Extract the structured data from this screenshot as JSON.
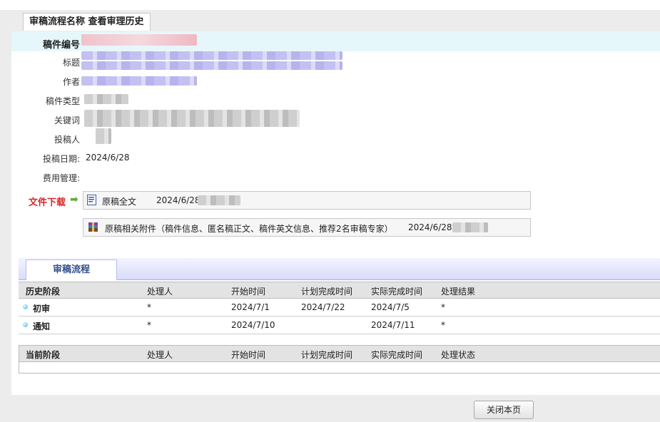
{
  "window_tab": "审稿流程名称 查看审理历史",
  "fields": {
    "manuscript_no": "稿件编号",
    "title": "标题",
    "author": "作者",
    "type": "稿件类型",
    "keywords": "关键词",
    "submitter": "投稿人",
    "submit_date_label": "投稿日期:",
    "submit_date_value": "2024/6/28",
    "fee_mgmt": "费用管理:"
  },
  "downloads": {
    "label": "文件下载",
    "files": [
      {
        "name": "原稿全文",
        "date": "2024/6/28"
      },
      {
        "name": "原稿相关附件（稿件信息、匿名稿正文、稿件英文信息、推荐2名审稿专家）",
        "date": "2024/6/28"
      }
    ]
  },
  "section_tab": "审稿流程",
  "history": {
    "headers": [
      "历史阶段",
      "处理人",
      "开始时间",
      "计划完成时间",
      "实际完成时间",
      "处理结果"
    ],
    "rows": [
      {
        "stage": "初审",
        "handler": "*",
        "start": "2024/7/1",
        "plan": "2024/7/22",
        "actual": "2024/7/5",
        "result": "*"
      },
      {
        "stage": "通知",
        "handler": "*",
        "start": "2024/7/10",
        "plan": "",
        "actual": "2024/7/11",
        "result": "*"
      }
    ]
  },
  "current": {
    "headers": [
      "当前阶段",
      "处理人",
      "开始时间",
      "计划完成时间",
      "实际完成时间",
      "处理状态"
    ]
  },
  "close_button": "关闭本页",
  "colors": {
    "download_label": "#d8262b",
    "section_tab_text": "#35508c",
    "highlight_row": "#e6f7fb"
  }
}
